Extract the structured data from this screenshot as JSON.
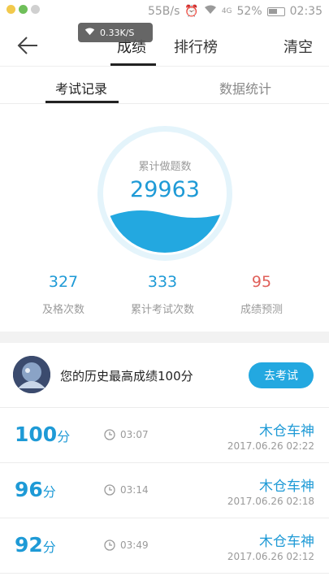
{
  "status_bar": {
    "speed": "55B/s",
    "battery": "52%",
    "time": "02:35",
    "network": "4G"
  },
  "toast": {
    "text": "0.33K/S"
  },
  "header": {
    "tabs": [
      "成绩",
      "排行榜"
    ],
    "clear_label": "清空"
  },
  "subtabs": [
    "考试记录",
    "数据统计"
  ],
  "summary": {
    "label": "累计做题数",
    "value": "29963"
  },
  "stats": [
    {
      "value": "327",
      "label": "及格次数"
    },
    {
      "value": "333",
      "label": "累计考试次数"
    },
    {
      "value": "95",
      "label": "成绩预测"
    }
  ],
  "best": {
    "text": "您的历史最高成绩100分",
    "button_label": "去考试"
  },
  "records": [
    {
      "score": "100",
      "unit": "分",
      "duration": "03:07",
      "name": "木仓车神",
      "date": "2017.06.26  02:22"
    },
    {
      "score": "96",
      "unit": "分",
      "duration": "03:14",
      "name": "木仓车神",
      "date": "2017.06.26  02:18"
    },
    {
      "score": "92",
      "unit": "分",
      "duration": "03:49",
      "name": "木仓车神",
      "date": "2017.06.26  02:12"
    }
  ],
  "colors": {
    "accent": "#1e9ad6",
    "prediction": "#e0605a",
    "button": "#23a8e0"
  }
}
